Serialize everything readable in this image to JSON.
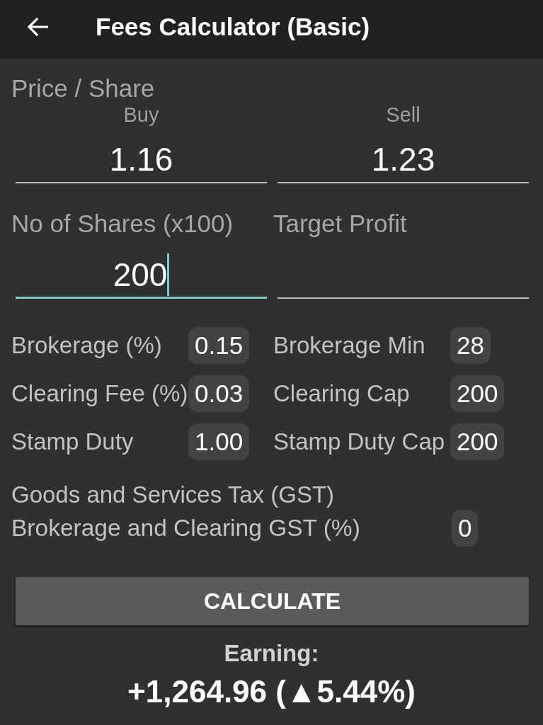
{
  "app_bar": {
    "title": "Fees Calculator (Basic)"
  },
  "price_per_share": {
    "label": "Price / Share",
    "fields": [
      {
        "label": "Buy",
        "value": "1.16",
        "focused": false
      },
      {
        "label": "Sell",
        "value": "1.23",
        "focused": false
      }
    ]
  },
  "inputs": [
    {
      "label": "No of Shares (x100)",
      "value": "200",
      "focused": true
    },
    {
      "label": "Target Profit",
      "focused": false
    }
  ],
  "fees": [
    {
      "label": "Brokerage (%)",
      "value": "0.15"
    },
    {
      "label": "Brokerage Min",
      "value": "28"
    },
    {
      "label": "Clearing Fee (%)",
      "value": "0.03"
    },
    {
      "label": "Clearing Cap",
      "value": "200"
    },
    {
      "label": "Stamp Duty",
      "value": "1.00"
    },
    {
      "label": "Stamp Duty Cap",
      "value": "200"
    }
  ],
  "gst": {
    "heading": "Goods and Services Tax (GST)",
    "label": "Brokerage and Clearing GST (%)",
    "value": "0"
  },
  "calculate_button": {
    "label": "CALCULATE"
  },
  "result": {
    "label": "Earning:",
    "value": "+1,264.96 (▲5.44%)"
  }
}
